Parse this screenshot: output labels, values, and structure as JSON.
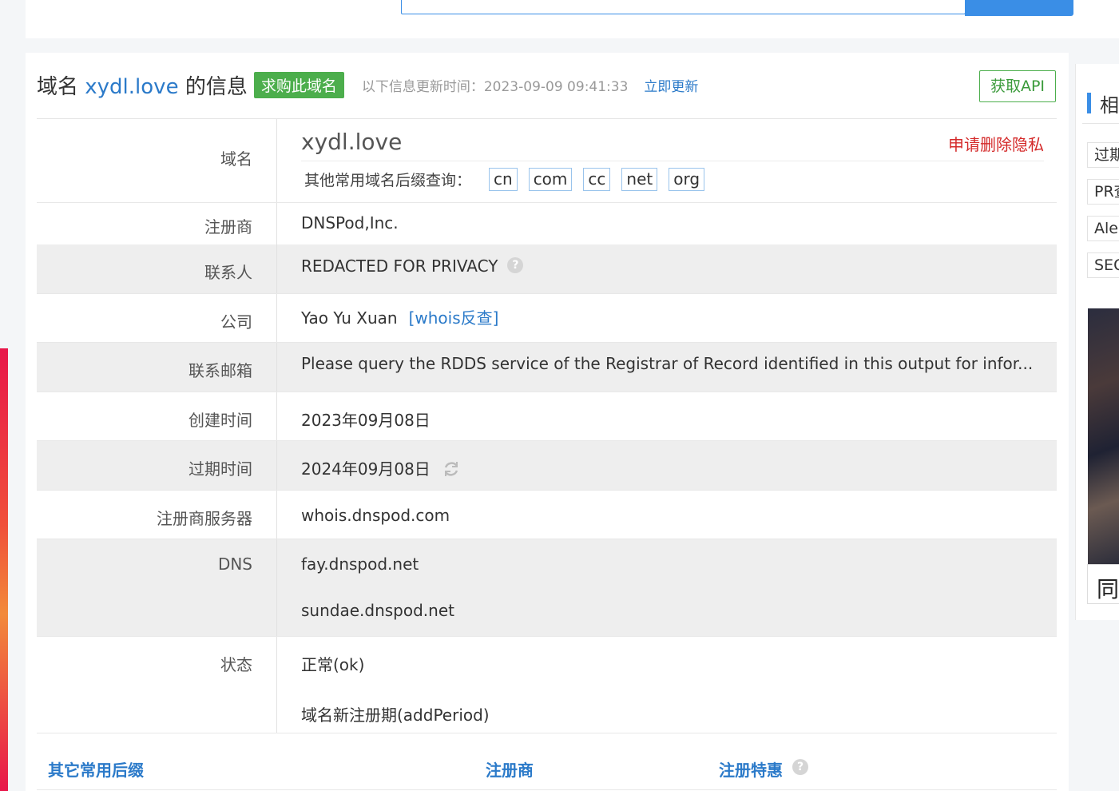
{
  "header": {
    "title_prefix": "域名",
    "domain": "xydl.love",
    "title_suffix": "的信息",
    "buy_label": "求购此域名",
    "update_text": "以下信息更新时间：2023-09-09 09:41:33",
    "update_link": "立即更新",
    "api_label": "获取API"
  },
  "rows": {
    "domain": {
      "label": "域名",
      "value": "xydl.love",
      "privacy_link": "申请删除隐私",
      "suffix_prompt": "其他常用域名后缀查询：",
      "suffixes": [
        "cn",
        "com",
        "cc",
        "net",
        "org"
      ]
    },
    "registrar": {
      "label": "注册商",
      "value": "DNSPod,Inc."
    },
    "contact": {
      "label": "联系人",
      "value": "REDACTED FOR PRIVACY",
      "help_icon": "question-circle-icon"
    },
    "company": {
      "label": "公司",
      "value": "Yao Yu Xuan",
      "link": "[whois反查]"
    },
    "email": {
      "label": "联系邮箱",
      "value": "Please query the RDDS service of the Registrar of Record identified in this output for infor..."
    },
    "created": {
      "label": "创建时间",
      "value": "2023年09月08日"
    },
    "expires": {
      "label": "过期时间",
      "value": "2024年09月08日",
      "icon": "refresh-icon"
    },
    "whois_server": {
      "label": "注册商服务器",
      "value": "whois.dnspod.com"
    },
    "dns": {
      "label": "DNS",
      "values": [
        "fay.dnspod.net",
        "sundae.dnspod.net"
      ]
    },
    "status": {
      "label": "状态",
      "values": [
        "正常(ok)",
        "域名新注册期(addPeriod)"
      ]
    }
  },
  "bottom_table": {
    "headers": [
      "其它常用后缀",
      "注册商",
      "注册特惠"
    ]
  },
  "sidebar": {
    "title": "相",
    "tags": [
      "过期",
      "PR查",
      "Ale",
      "SEO"
    ],
    "image_caption": "同"
  },
  "colors": {
    "link": "#2b7ac9",
    "green": "#4cae4c",
    "red": "#d42a2a",
    "row_gray": "#eeeeee",
    "accent_blue": "#3a8ee6"
  }
}
